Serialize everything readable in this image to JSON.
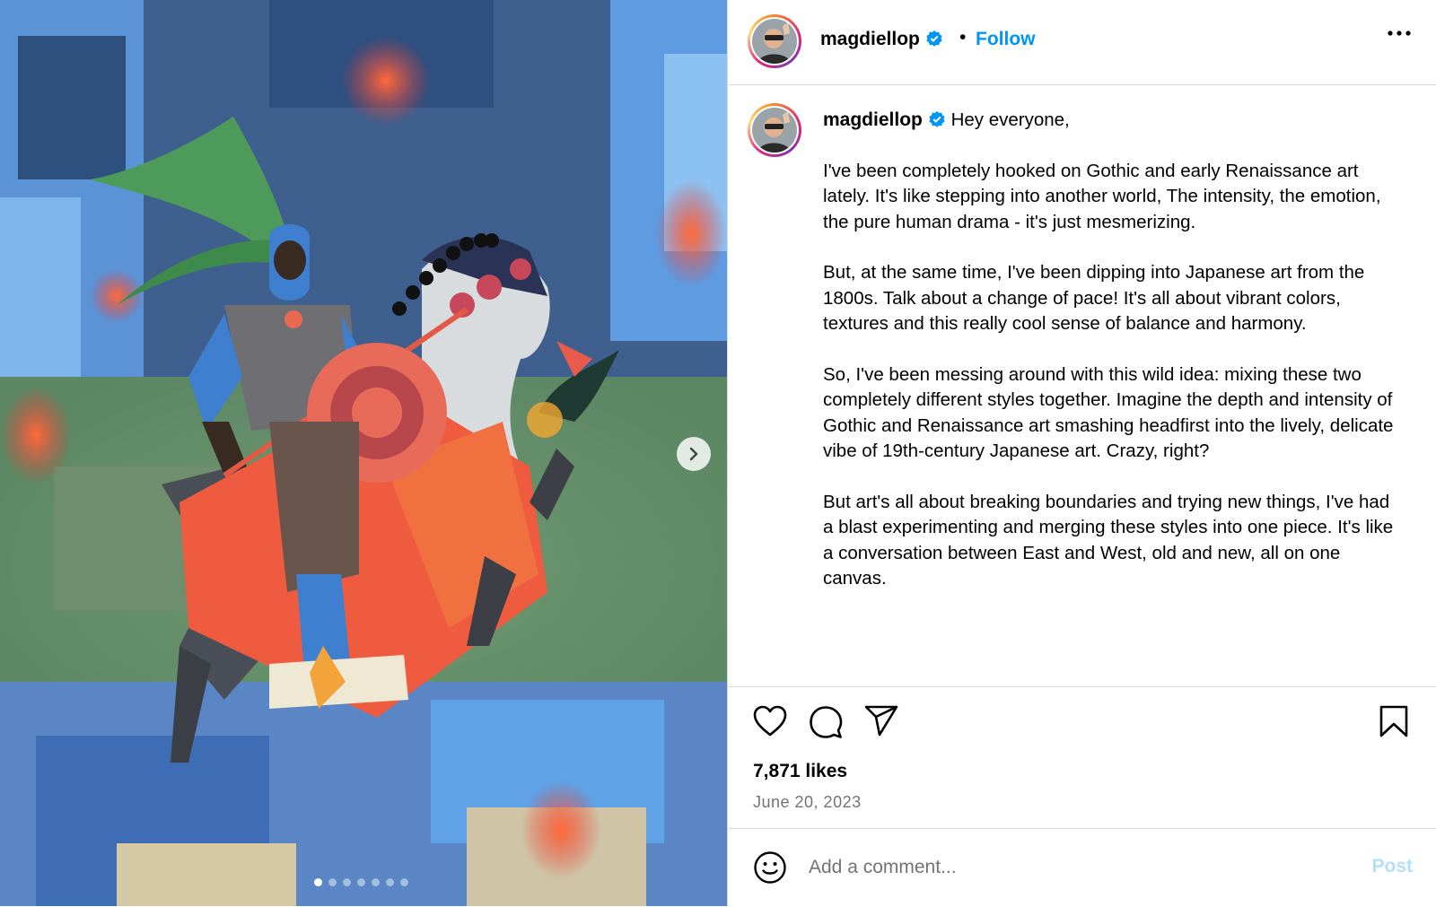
{
  "post": {
    "username": "magdiellop",
    "follow_label": "Follow",
    "separator": "•",
    "caption": {
      "greeting": "Hey everyone,",
      "paragraphs": [
        "I've been completely hooked on Gothic and early Renaissance art lately. It's like stepping into another world, The intensity, the emotion, the pure human drama - it's just mesmerizing.",
        "But, at the same time, I've been dipping into Japanese art from the 1800s. Talk about a change of pace! It's all about vibrant colors, textures and this really cool sense of balance and harmony.",
        "So, I've been messing around with this wild idea: mixing these two completely different styles together. Imagine the depth and intensity of Gothic and Renaissance art smashing headfirst into the lively, delicate vibe of 19th-century Japanese art. Crazy, right?",
        "But art's all about breaking boundaries and trying new things, I've had a blast experimenting and merging these styles into one piece. It's like a conversation between East and West, old and new, all on one canvas."
      ]
    },
    "likes": "7,871 likes",
    "date": "June 20, 2023",
    "comment": {
      "placeholder": "Add a comment...",
      "post_label": "Post"
    },
    "carousel": {
      "total": 7,
      "active": 0
    }
  },
  "colors": {
    "follow": "#0095f6",
    "post_disabled": "#b3dffc",
    "verified": "#0095f6"
  },
  "icons": [
    "verified-badge-icon",
    "more-options-icon",
    "heart-icon",
    "comment-icon",
    "share-icon",
    "bookmark-icon",
    "emoji-icon",
    "chevron-right-icon"
  ]
}
